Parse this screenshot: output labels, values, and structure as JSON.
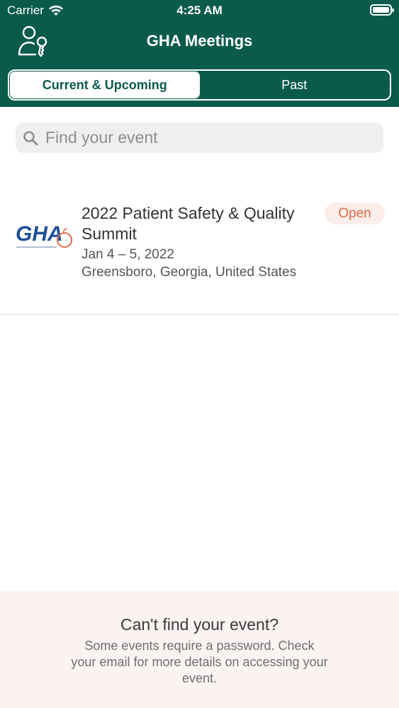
{
  "status_bar": {
    "carrier": "Carrier",
    "time": "4:25 AM"
  },
  "nav": {
    "title": "GHA Meetings",
    "login_icon": "user-key-icon"
  },
  "tabs": [
    {
      "label": "Current & Upcoming",
      "selected": true
    },
    {
      "label": "Past",
      "selected": false
    }
  ],
  "search": {
    "placeholder": "Find your event",
    "icon": "search-icon"
  },
  "events": [
    {
      "title": "2022 Patient Safety & Quality Summit",
      "dates": "Jan 4 – 5, 2022",
      "location": "Greensboro, Georgia, United States",
      "status": "Open",
      "logo_text": "GHA"
    }
  ],
  "footer": {
    "title": "Can't find your event?",
    "text": "Some events require a password. Check your email for more details on accessing your event."
  },
  "colors": {
    "brand": "#0b5b4c",
    "status_open": "#e06b4b",
    "status_open_bg": "#fbeeea",
    "logo_blue": "#1d4f9b"
  }
}
